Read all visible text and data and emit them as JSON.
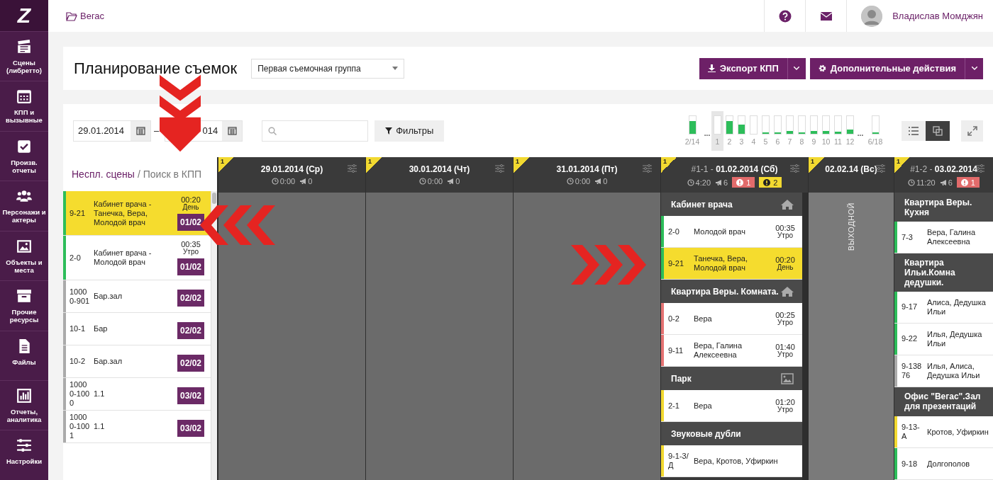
{
  "sidebar": {
    "logo": "Z",
    "items": [
      {
        "label": "Сцены (либретто)"
      },
      {
        "label": "КПП и вызывные"
      },
      {
        "label": "Произв. отчеты"
      },
      {
        "label": "Персонажи и актеры"
      },
      {
        "label": "Объекты и места"
      },
      {
        "label": "Прочие ресурсы"
      },
      {
        "label": "Файлы"
      },
      {
        "label": "Отчеты, аналитика"
      },
      {
        "label": "Настройки"
      }
    ]
  },
  "topbar": {
    "breadcrumb": "Вегас",
    "user_name": "Владислав Момджян"
  },
  "title_panel": {
    "title": "Планирование съемок",
    "group_select": "Первая съемочная группа",
    "buttons": [
      {
        "label": "Экспорт КПП"
      },
      {
        "label": "Дополнительные действия"
      }
    ]
  },
  "toolbar": {
    "date_from": "29.01.2014",
    "date_separator": "–",
    "date_to": "014",
    "filter_button": "Фильтры",
    "day_meter": [
      {
        "kind": "bar",
        "label": "2/14",
        "level": 0.7,
        "selected": false
      },
      {
        "kind": "gap",
        "label": "..."
      },
      {
        "kind": "bar",
        "label": "1",
        "level": 0,
        "selected": true
      },
      {
        "kind": "bar",
        "label": "2",
        "level": 0.7,
        "selected": false
      },
      {
        "kind": "bar",
        "label": "3",
        "level": 0.5,
        "selected": false
      },
      {
        "kind": "bar",
        "label": "4",
        "level": 0,
        "selected": false
      },
      {
        "kind": "bar",
        "label": "5",
        "level": 0.08,
        "selected": false
      },
      {
        "kind": "bar",
        "label": "6",
        "level": 0.05,
        "selected": false
      },
      {
        "kind": "bar",
        "label": "7",
        "level": 0.13,
        "selected": false
      },
      {
        "kind": "bar",
        "label": "8",
        "level": 0.05,
        "selected": false
      },
      {
        "kind": "bar",
        "label": "9",
        "level": 0.13,
        "selected": false
      },
      {
        "kind": "bar",
        "label": "10",
        "level": 0.13,
        "selected": false
      },
      {
        "kind": "bar",
        "label": "11",
        "level": 0.1,
        "selected": false
      },
      {
        "kind": "bar",
        "label": "12",
        "level": 0.22,
        "selected": false
      },
      {
        "kind": "gap",
        "label": "..."
      },
      {
        "kind": "bar",
        "label": "6/18",
        "level": 0.05,
        "selected": false
      }
    ],
    "view_toggle": [
      {
        "selected": false
      },
      {
        "selected": true
      }
    ]
  },
  "scene_list": {
    "tabs": [
      {
        "label": "Неспл. сцены",
        "selected": true
      },
      {
        "label": "Поиск в КПП",
        "selected": false
      }
    ],
    "separator": "/",
    "items": [
      {
        "id": "9-21",
        "title": "Кабинет врача - Танечка, Вера, Молодой врач",
        "time": "00:20",
        "part": "День",
        "date": "01/02",
        "color": "#2dbd5a",
        "selected": true
      },
      {
        "id": "2-0",
        "title": "Кабинет врача - Молодой врач",
        "time": "00:35",
        "part": "Утро",
        "date": "01/02",
        "color": "#2dbd5a",
        "selected": false
      },
      {
        "id": "10000-901",
        "title": "Бар.зал",
        "date": "02/02",
        "color": "#aaaaaa",
        "selected": false
      },
      {
        "id": "10-1",
        "title": "Бар",
        "date": "02/02",
        "color": "#aaaaaa",
        "selected": false
      },
      {
        "id": "10-2",
        "title": "Бар.зал",
        "date": "02/02",
        "color": "#aaaaaa",
        "selected": false
      },
      {
        "id": "10000-1000",
        "title": "1.1",
        "date": "03/02",
        "color": "#aaaaaa",
        "selected": false
      },
      {
        "id": "10000-1001",
        "title": "1.1",
        "date": "03/02",
        "color": "#aaaaaa",
        "selected": false
      }
    ]
  },
  "days": [
    {
      "kind": "day",
      "badge": "1",
      "date": "29.01.2014 (Ср)",
      "duration": "0:00",
      "calls": "0"
    },
    {
      "kind": "day",
      "badge": "1",
      "date": "30.01.2014 (Чт)",
      "duration": "0:00",
      "calls": "0"
    },
    {
      "kind": "day",
      "badge": "1",
      "date": "31.01.2014 (Пт)",
      "duration": "0:00",
      "calls": "0"
    },
    {
      "kind": "day",
      "badge": "1",
      "prefix": "#1-1 - ",
      "date": "01.02.2014 (Сб)",
      "duration": "4:20",
      "calls": "6",
      "alerts": [
        {
          "kind": "error",
          "count": "1"
        },
        {
          "kind": "warning",
          "count": "2"
        }
      ],
      "groups": [
        {
          "location": "Кабинет врача",
          "kind": "home",
          "cards": [
            {
              "id": "2-0",
              "names": "Молодой врач",
              "time": "00:35",
              "part": "Утро",
              "color": "#2dbd5a",
              "selected": false
            },
            {
              "id": "9-21",
              "names": "Танечка, Вера, Молодой врач",
              "time": "00:20",
              "part": "День",
              "color": "#2dbd5a",
              "selected": true
            }
          ]
        },
        {
          "location": "Квартира Веры. Комната.",
          "kind": "home",
          "cards": [
            {
              "id": "0-2",
              "names": "Вера",
              "time": "00:25",
              "part": "Утро",
              "color": "#e57373",
              "selected": false
            },
            {
              "id": "9-11",
              "names": "Вера, Галина Алексеевна",
              "time": "01:40",
              "part": "Утро",
              "color": "#e57373",
              "selected": false
            }
          ]
        },
        {
          "location": "Парк",
          "kind": "image",
          "cards": [
            {
              "id": "2-1",
              "names": "Вера",
              "time": "01:20",
              "part": "Утро",
              "color": "#f2d930",
              "selected": false
            }
          ]
        },
        {
          "location": "Звуковые дубли",
          "cards": [
            {
              "id": "9-1-3/Д",
              "names": "Вера, Кротов, Уфиркин",
              "color": "#f2d930",
              "selected": false
            }
          ]
        }
      ]
    },
    {
      "kind": "holiday",
      "badge": "1",
      "date": "02.02.14 (Вс)",
      "label": "ВЫХОДНОЙ"
    },
    {
      "kind": "day",
      "badge": "1",
      "prefix": "#1-2 - ",
      "date": "03.02.2014",
      "duration": "11:20",
      "calls": "6",
      "alerts": [
        {
          "kind": "error",
          "count": "1"
        }
      ],
      "groups": [
        {
          "location": "Квартира Веры. Кухня",
          "cards": [
            {
              "id": "7-3",
              "names": "Вера, Галина Алексеевна",
              "color": "#2dbd5a",
              "selected": false
            }
          ]
        },
        {
          "location": "Квартира Ильи.Комна дедушки.",
          "cards": [
            {
              "id": "9-17",
              "names": "Алиса, Дедушка Ильи",
              "color": "#2dbd5a",
              "selected": false
            },
            {
              "id": "9-22",
              "names": "Илья, Дедушка Ильи",
              "color": "#2dbd5a",
              "selected": false
            },
            {
              "id": "9-13876",
              "names": "Илья, Алиса, Дедушка Ильи",
              "color": "#aaaaaa",
              "selected": false
            }
          ]
        },
        {
          "location": "Офис \"Вегас\".Зал для презентаций",
          "cards": [
            {
              "id": "9-13-А",
              "names": "Кротов, Уфиркин",
              "color": "#f2d930",
              "selected": false
            },
            {
              "id": "9-18",
              "names": "Долгополов",
              "color": "#2dbd5a",
              "selected": false
            }
          ]
        }
      ]
    }
  ],
  "annotations": [
    {
      "kind": "down"
    },
    {
      "kind": "left"
    },
    {
      "kind": "right"
    }
  ]
}
